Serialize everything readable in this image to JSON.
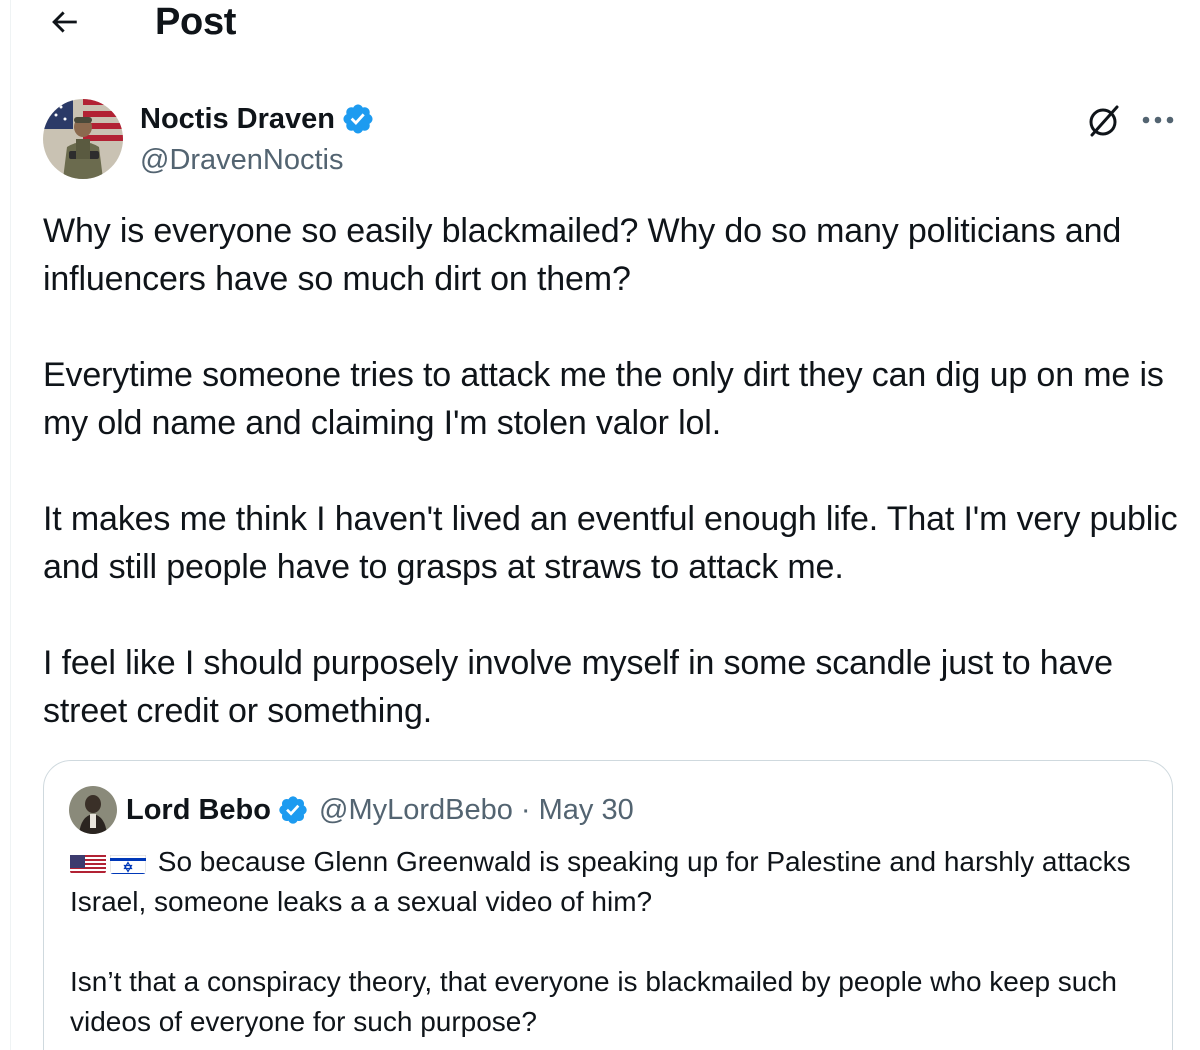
{
  "header": {
    "title": "Post",
    "back_icon": "arrow-left-icon"
  },
  "post": {
    "author_name": "Noctis Draven",
    "author_handle": "@DravenNoctis",
    "verified": true,
    "paragraphs": [
      "Why is everyone so easily blackmailed? Why do so many politicians and influencers have so much dirt on them?",
      "Everytime someone tries to attack me the only dirt they can dig up on me is my old name and claiming I'm stolen valor lol.",
      "It makes me think I haven't lived an eventful enough life. That I'm very public and still people have to grasps at straws to attack me.",
      "I feel like I should purposely involve myself in some scandle just to have street credit or something."
    ]
  },
  "quoted_post": {
    "author_name": "Lord Bebo",
    "meta": "@MyLordBebo · May 30",
    "verified": true,
    "flags": [
      "us-flag-icon",
      "israel-flag-icon"
    ],
    "paragraphs": [
      "So because Glenn Greenwald is speaking up for Palestine and harshly attacks Israel, someone leaks a a sexual video of him?",
      "Isn’t that a conspiracy theory, that everyone is blackmailed by people who keep such videos of everyone for such purpose?"
    ]
  },
  "colors": {
    "text": "#0f1419",
    "secondary": "#536471",
    "verified_blue": "#1d9bf0",
    "border": "#cfd9de"
  }
}
